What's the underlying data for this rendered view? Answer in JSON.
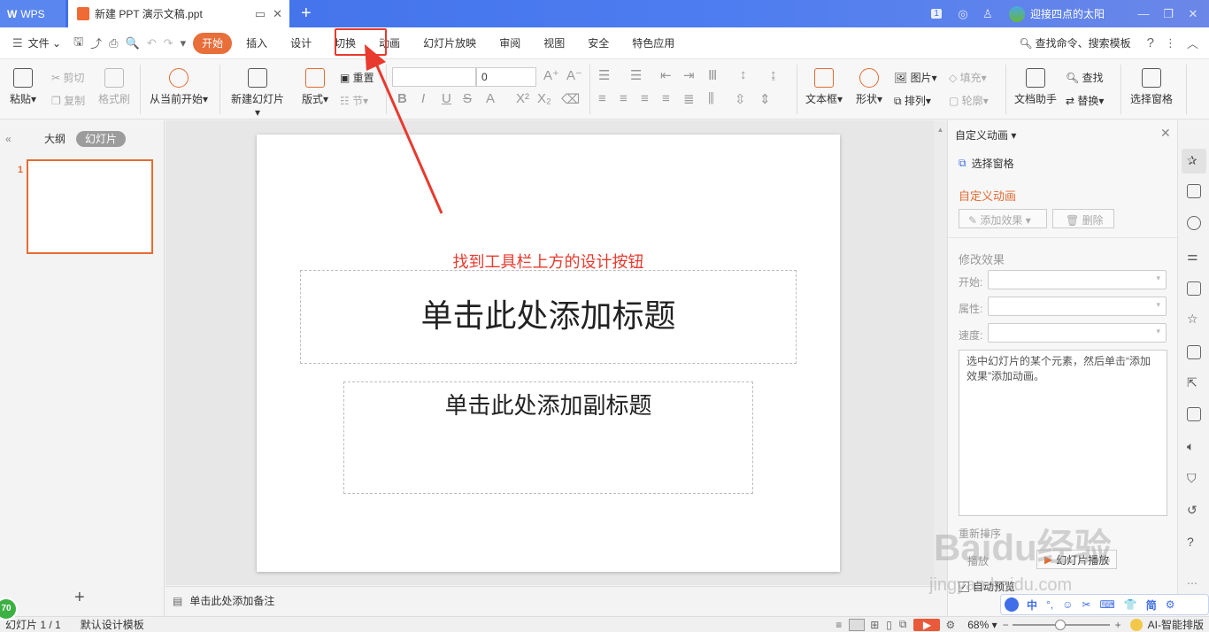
{
  "titlebar": {
    "app_name": "WPS",
    "doc_tab": "新建 PPT 演示文稿.ppt",
    "new_tab": "+",
    "page_badge": "1",
    "user_name": "迎接四点的太阳"
  },
  "menu": {
    "file": "文件",
    "items": [
      "开始",
      "插入",
      "设计",
      "切换",
      "动画",
      "幻灯片放映",
      "审阅",
      "视图",
      "安全",
      "特色应用"
    ],
    "search": "查找命令、搜索模板",
    "help": "?"
  },
  "ribbon": {
    "paste": "粘贴",
    "cut": "剪切",
    "copy": "复制",
    "format_painter": "格式刷",
    "from_current": "从当前开始",
    "new_slide": "新建幻灯片",
    "layout": "版式",
    "reset": "重置",
    "section": "节",
    "font_size": "0",
    "text_box": "文本框",
    "shape": "形状",
    "picture": "图片",
    "arrange": "排列",
    "fill": "填充",
    "outline": "轮廓",
    "doc_assistant": "文档助手",
    "find": "查找",
    "replace": "替换",
    "select_pane": "选择窗格"
  },
  "leftpane": {
    "outline_tab": "大纲",
    "slides_tab": "幻灯片",
    "slide_number": "1",
    "add": "+"
  },
  "slide": {
    "annotation": "找到工具栏上方的设计按钮",
    "title_placeholder": "单击此处添加标题",
    "subtitle_placeholder": "单击此处添加副标题",
    "notes_placeholder": "单击此处添加备注"
  },
  "rightpane": {
    "header": "自定义动画",
    "select_pane": "选择窗格",
    "section_title": "自定义动画",
    "add_effect": "添加效果",
    "delete": "删除",
    "modify_effect": "修改效果",
    "start_label": "开始:",
    "property_label": "属性:",
    "speed_label": "速度:",
    "hint": "选中幻灯片的某个元素，然后单击“添加效果”添加动画。",
    "reorder": "重新排序",
    "play": "播放",
    "slideshow": "幻灯片播放",
    "auto_preview": "自动预览"
  },
  "statusbar": {
    "slide_count": "幻灯片 1 / 1",
    "template": "默认设计模板",
    "zoom": "68%",
    "ai_layout": "AI-智能排版",
    "level_badge": "70"
  },
  "watermark": {
    "text": "Baidu经验",
    "url": "jingyan.baidu.com"
  },
  "ime": {
    "items": [
      "中",
      "°,",
      "☺",
      "✂",
      "⌨",
      "👕",
      "简",
      "⚙"
    ]
  }
}
